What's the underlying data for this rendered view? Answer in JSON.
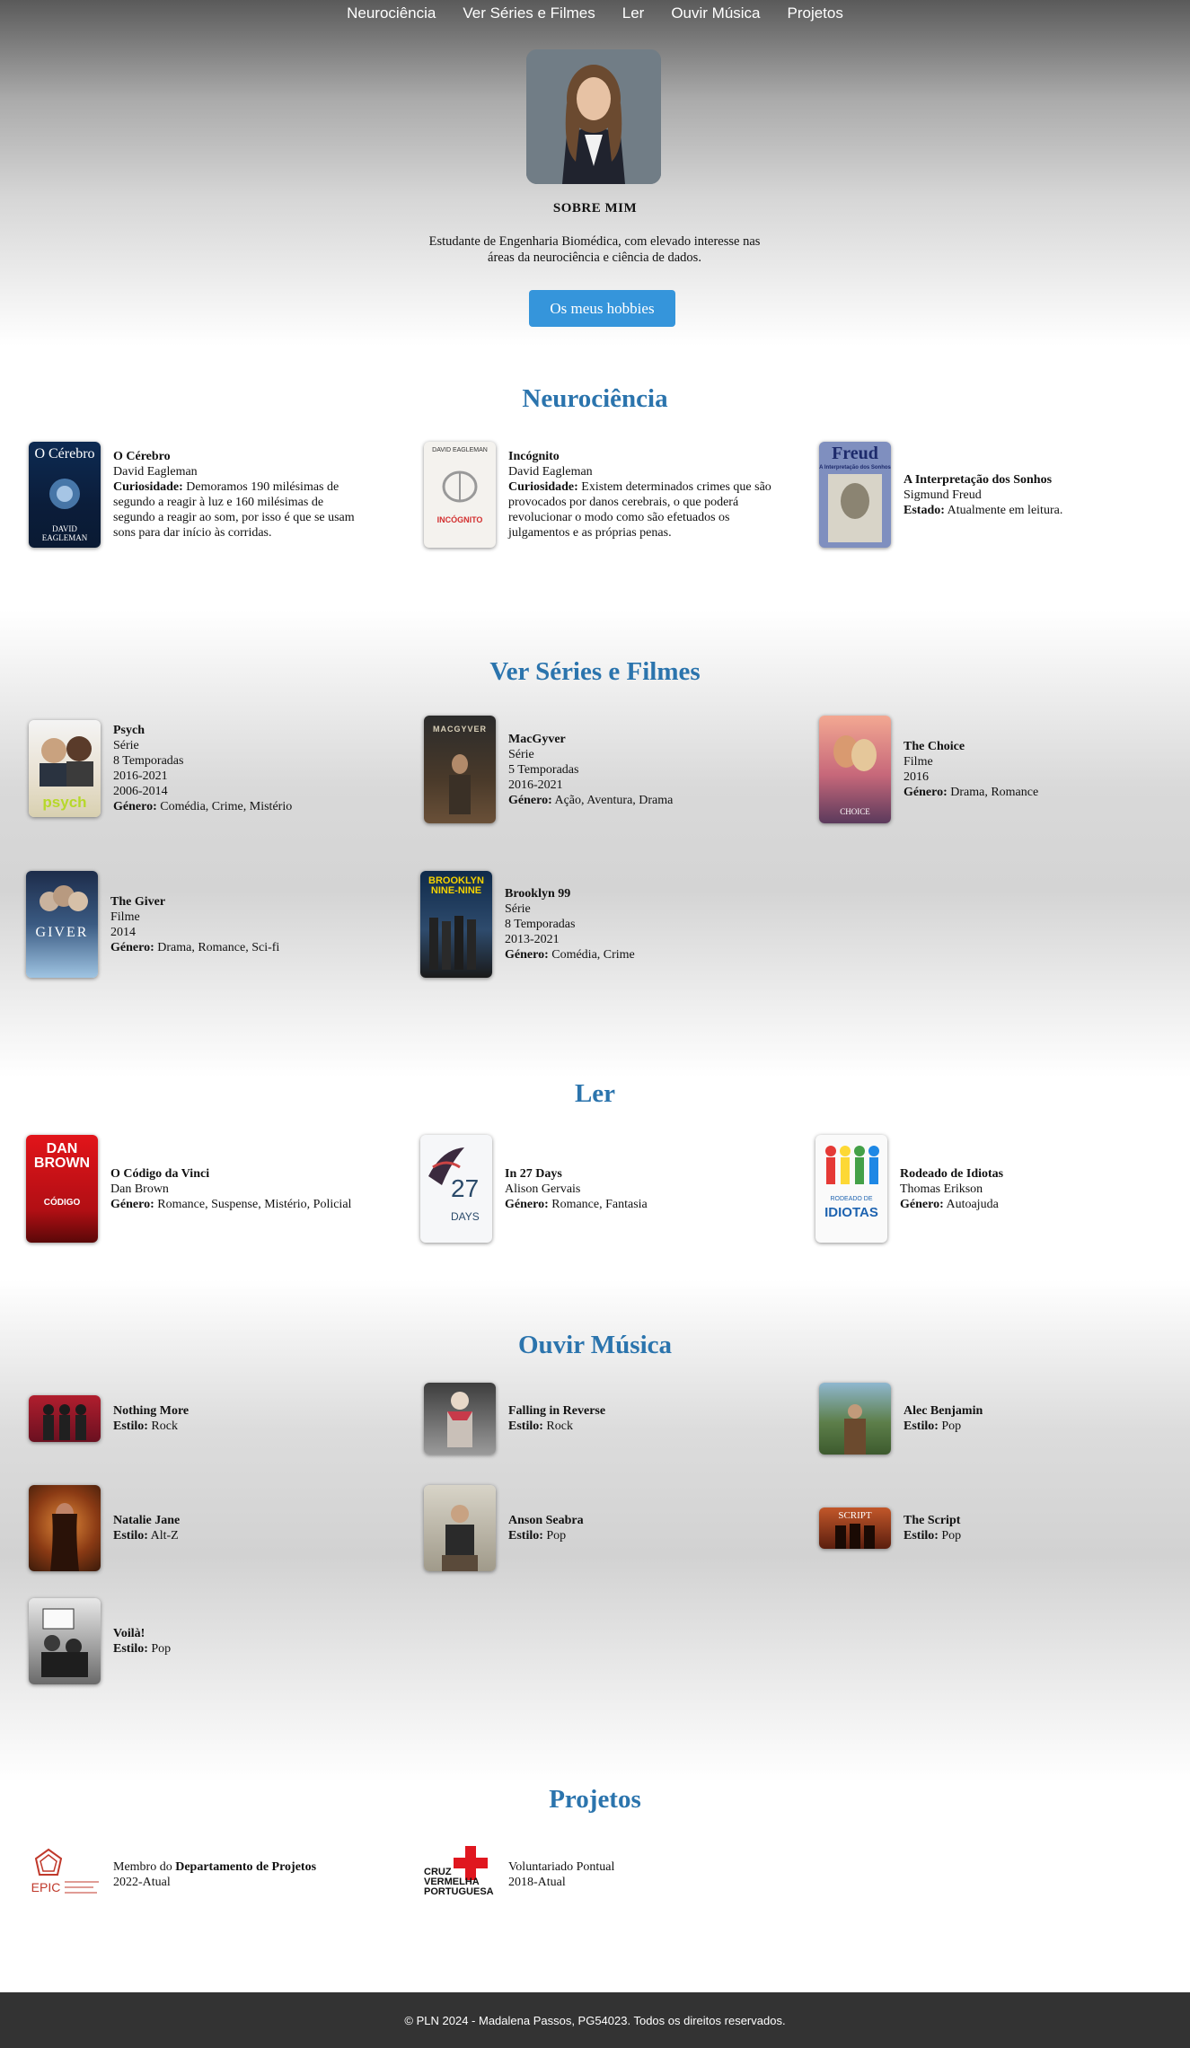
{
  "nav": [
    "Neurociência",
    "Ver Séries e Filmes",
    "Ler",
    "Ouvir Música",
    "Projetos"
  ],
  "about": {
    "title": "SOBRE MIM",
    "text": "Estudante de Engenharia Biomédica, com elevado interesse nas áreas da neurociência e ciência de dados.",
    "button": "Os meus hobbies"
  },
  "neuro": {
    "title": "Neurociência",
    "items": [
      {
        "cover": "O Cérebro",
        "cover_author": "DAVID EAGLEMAN",
        "title": "O Cérebro",
        "author": "David Eagleman",
        "label": "Curiosidade:",
        "text": "Demoramos 190 milésimas de segundo a reagir à luz e 160 milésimas de segundo a reagir ao som, por isso é que se usam sons para dar início às corridas."
      },
      {
        "cover": "INCÓGNITO",
        "cover_author": "DAVID EAGLEMAN",
        "title": "Incógnito",
        "author": "David Eagleman",
        "label": "Curiosidade:",
        "text": "Existem determinados crimes que são provocados por danos cerebrais, o que poderá revolucionar o modo como são efetuados os julgamentos e as próprias penas."
      },
      {
        "cover": "Freud",
        "cover_author": "A Interpretação dos Sonhos",
        "title": "A Interpretação dos Sonhos",
        "author": "Sigmund Freud",
        "label": "Estado:",
        "text": "Atualmente em leitura."
      }
    ]
  },
  "series": {
    "title": "Ver Séries e Filmes",
    "items": [
      {
        "cover": "psych",
        "title": "Psych",
        "lines": [
          "Série",
          "8 Temporadas",
          "2016-2021",
          "2006-2014"
        ],
        "genre_label": "Género:",
        "genre": "Comédia, Crime, Mistério"
      },
      {
        "cover": "MACGYVER",
        "title": "MacGyver",
        "lines": [
          "Série",
          "5 Temporadas",
          "2016-2021"
        ],
        "genre_label": "Género:",
        "genre": "Ação, Aventura, Drama"
      },
      {
        "cover": "CHOICE",
        "title": "The Choice",
        "lines": [
          "Filme",
          "2016"
        ],
        "genre_label": "Género:",
        "genre": "Drama, Romance"
      },
      {
        "cover": "GIVER",
        "title": "The Giver",
        "lines": [
          "Filme",
          "2014"
        ],
        "genre_label": "Género:",
        "genre": "Drama, Romance, Sci-fi"
      },
      {
        "cover": "BROOKLYN NINE-NINE",
        "title": "Brooklyn 99",
        "lines": [
          "Série",
          "8 Temporadas",
          "2013-2021"
        ],
        "genre_label": "Género:",
        "genre": "Comédia, Crime"
      }
    ]
  },
  "read": {
    "title": "Ler",
    "items": [
      {
        "cover": "DAN BROWN",
        "cover_sub": "CÓDIGO",
        "title": "O Código da Vinci",
        "author": "Dan Brown",
        "genre_label": "Género:",
        "genre": "Romance, Suspense, Mistério, Policial"
      },
      {
        "cover": "27",
        "cover_sub": "DAYS",
        "title": "In 27 Days",
        "author": "Alison Gervais",
        "genre_label": "Género:",
        "genre": "Romance, Fantasia"
      },
      {
        "cover": "RODEADO DE",
        "cover_sub": "IDIOTAS",
        "title": "Rodeado de Idiotas",
        "author": "Thomas Erikson",
        "genre_label": "Género:",
        "genre": "Autoajuda"
      }
    ]
  },
  "music": {
    "title": "Ouvir Música",
    "style_label": "Estilo:",
    "items": [
      {
        "name": "Nothing More",
        "style": "Rock"
      },
      {
        "name": "Falling in Reverse",
        "style": "Rock"
      },
      {
        "name": "Alec Benjamin",
        "style": "Pop"
      },
      {
        "name": "Natalie Jane",
        "style": "Alt-Z"
      },
      {
        "name": "Anson Seabra",
        "style": "Pop"
      },
      {
        "name": "The Script",
        "style": "Pop"
      },
      {
        "name": "Voilà!",
        "style": "Pop"
      }
    ]
  },
  "projects": {
    "title": "Projetos",
    "items": [
      {
        "logo": "EPIC",
        "prefix": "Membro do ",
        "bold": "Departamento de Projetos",
        "period": "2022-Atual"
      },
      {
        "logo": "CRUZ VERMELHA PORTUGUESA",
        "prefix": "Voluntariado Pontual",
        "bold": "",
        "period": "2018-Atual"
      }
    ]
  },
  "footer": "© PLN 2024 - Madalena Passos, PG54023. Todos os direitos reservados."
}
